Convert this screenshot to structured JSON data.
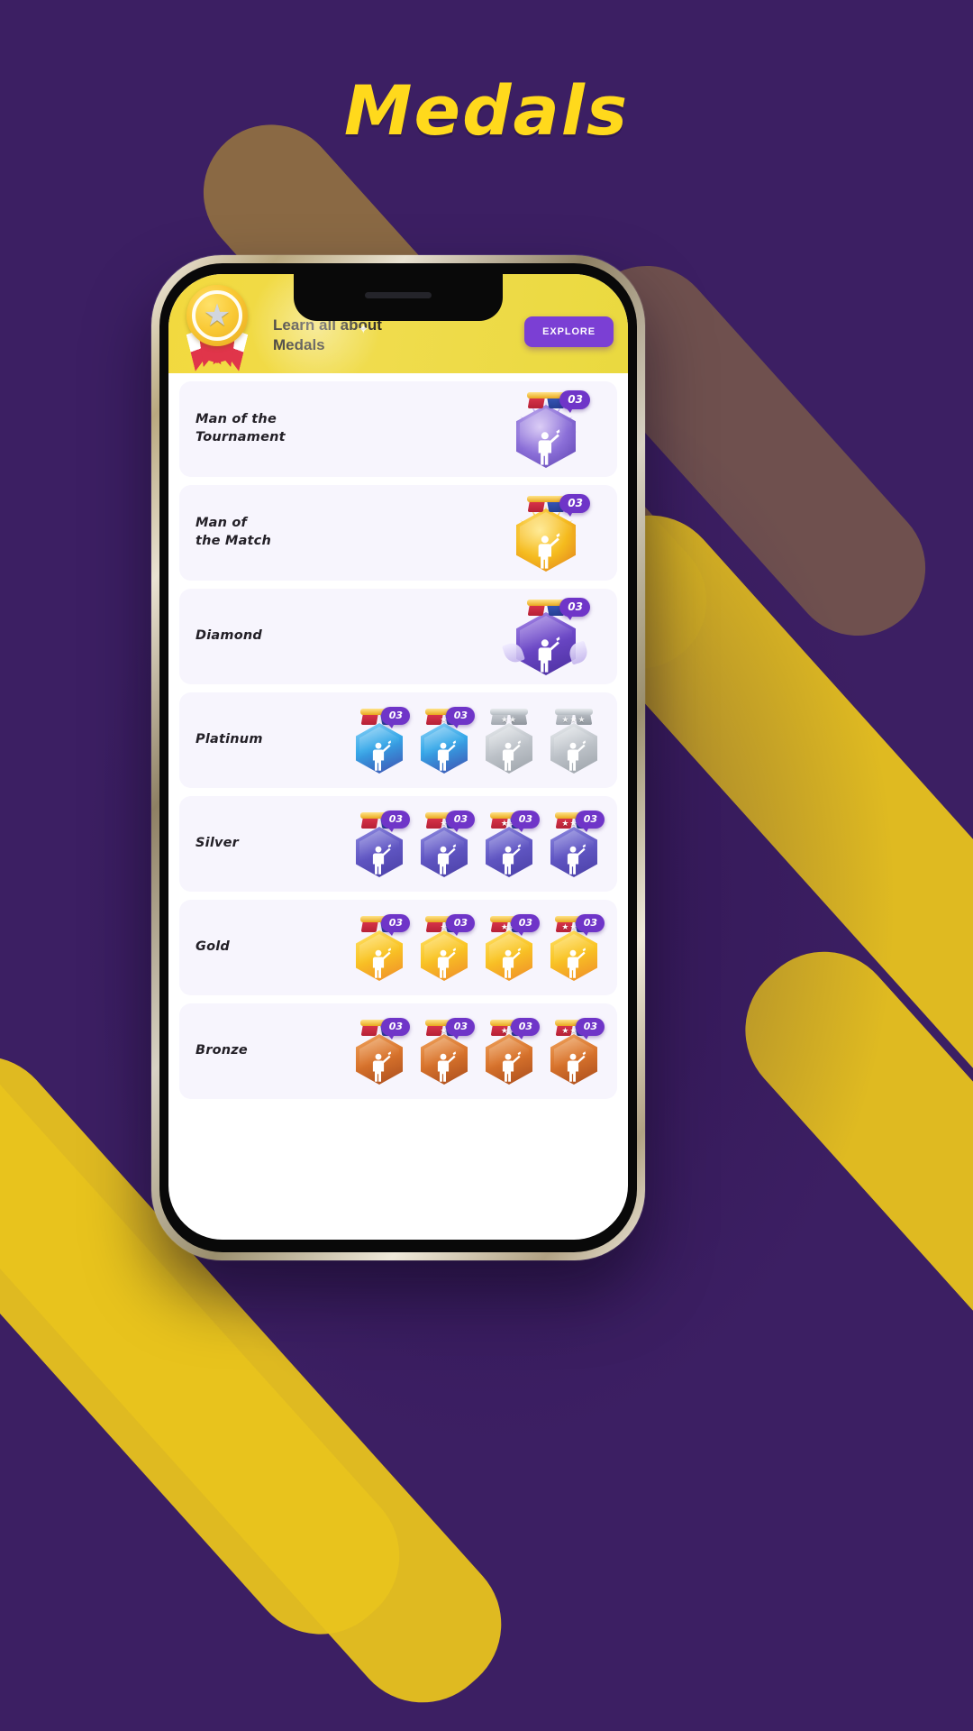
{
  "page": {
    "title": "Medals",
    "background_color": "#3c1f63",
    "accent_color": "#e8c31e",
    "title_color": "#ffd91c"
  },
  "banner": {
    "text_line1": "Learn all about",
    "text_line2": "Medals",
    "button_label": "EXPLORE",
    "button_color": "#7b3fd4",
    "background_color": "#f0dc4d",
    "icon": "rosette-medal-icon"
  },
  "rows": [
    {
      "label": "Man of the\nTournament",
      "label_line1": "Man of the",
      "label_line2": "Tournament",
      "style": "mott",
      "medals": [
        {
          "count": "03",
          "stars": 0,
          "locked": false,
          "size": "big",
          "tier": "man-of-the-tournament"
        }
      ]
    },
    {
      "label": "Man of\nthe Match",
      "label_line1": "Man of",
      "label_line2": "the Match",
      "style": "mom",
      "medals": [
        {
          "count": "03",
          "stars": 0,
          "locked": false,
          "size": "big",
          "tier": "man-of-the-match"
        }
      ]
    },
    {
      "label": "Diamond",
      "label_line1": "Diamond",
      "label_line2": "",
      "style": "diamond",
      "medals": [
        {
          "count": "03",
          "stars": 0,
          "locked": false,
          "size": "big",
          "tier": "diamond"
        }
      ]
    },
    {
      "label": "Platinum",
      "label_line1": "Platinum",
      "label_line2": "",
      "style": "platinum",
      "medals": [
        {
          "count": "03",
          "stars": 0,
          "locked": false,
          "size": "normal",
          "tier": "platinum-1"
        },
        {
          "count": "03",
          "stars": 1,
          "locked": false,
          "size": "normal",
          "tier": "platinum-2"
        },
        {
          "count": "",
          "stars": 2,
          "locked": true,
          "size": "normal",
          "tier": "platinum-3"
        },
        {
          "count": "",
          "stars": 3,
          "locked": true,
          "size": "normal",
          "tier": "platinum-4"
        }
      ]
    },
    {
      "label": "Silver",
      "label_line1": "Silver",
      "label_line2": "",
      "style": "silver",
      "medals": [
        {
          "count": "03",
          "stars": 0,
          "locked": false,
          "size": "normal",
          "tier": "silver-1"
        },
        {
          "count": "03",
          "stars": 1,
          "locked": false,
          "size": "normal",
          "tier": "silver-2"
        },
        {
          "count": "03",
          "stars": 2,
          "locked": false,
          "size": "normal",
          "tier": "silver-3"
        },
        {
          "count": "03",
          "stars": 3,
          "locked": false,
          "size": "normal",
          "tier": "silver-4"
        }
      ]
    },
    {
      "label": "Gold",
      "label_line1": "Gold",
      "label_line2": "",
      "style": "gold",
      "medals": [
        {
          "count": "03",
          "stars": 0,
          "locked": false,
          "size": "normal",
          "tier": "gold-1"
        },
        {
          "count": "03",
          "stars": 1,
          "locked": false,
          "size": "normal",
          "tier": "gold-2"
        },
        {
          "count": "03",
          "stars": 2,
          "locked": false,
          "size": "normal",
          "tier": "gold-3"
        },
        {
          "count": "03",
          "stars": 3,
          "locked": false,
          "size": "normal",
          "tier": "gold-4"
        }
      ]
    },
    {
      "label": "Bronze",
      "label_line1": "Bronze",
      "label_line2": "",
      "style": "bronze",
      "medals": [
        {
          "count": "03",
          "stars": 0,
          "locked": false,
          "size": "normal",
          "tier": "bronze-1"
        },
        {
          "count": "03",
          "stars": 1,
          "locked": false,
          "size": "normal",
          "tier": "bronze-2"
        },
        {
          "count": "03",
          "stars": 2,
          "locked": false,
          "size": "normal",
          "tier": "bronze-3"
        },
        {
          "count": "03",
          "stars": 3,
          "locked": false,
          "size": "normal",
          "tier": "bronze-4"
        }
      ]
    }
  ]
}
